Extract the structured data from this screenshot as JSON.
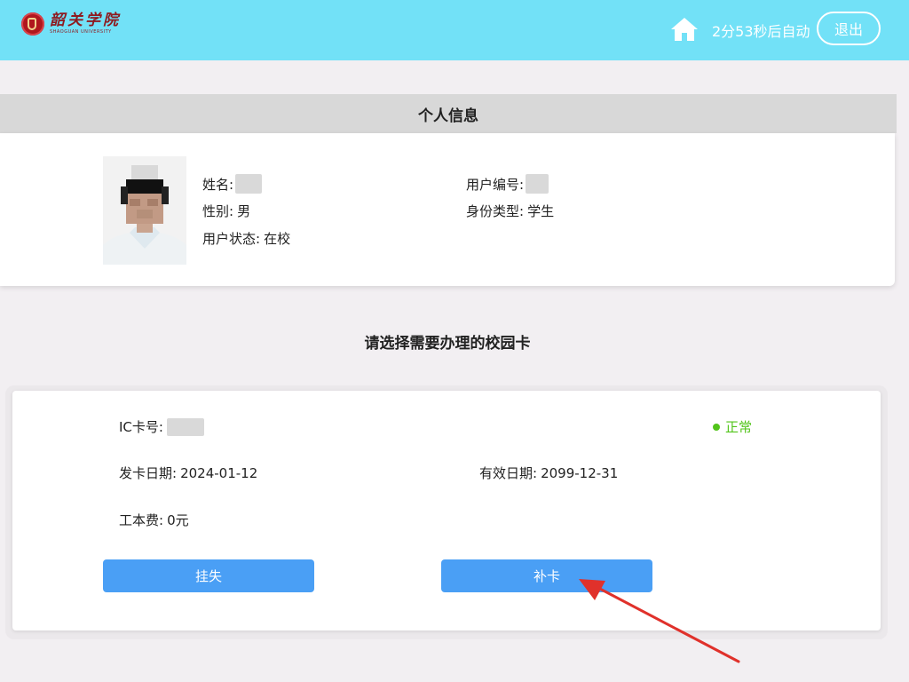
{
  "header": {
    "logo_cn": "韶关学院",
    "logo_en": "SHAOGUAN UNIVERSITY",
    "home_icon": "home-icon",
    "countdown": "2分53秒后自动",
    "logout_label": "退出"
  },
  "profile": {
    "section_title": "个人信息",
    "name_label": "姓名:",
    "user_id_label": "用户编号:",
    "gender_label": "性别:",
    "gender_value": "男",
    "identity_label": "身份类型:",
    "identity_value": "学生",
    "status_label": "用户状态:",
    "status_value": "在校"
  },
  "select_prompt": "请选择需要办理的校园卡",
  "card": {
    "ic_label": "IC卡号:",
    "status": "正常",
    "issue_label": "发卡日期:",
    "issue_date": "2024-01-12",
    "expiry_label": "有效日期:",
    "expiry_date": "2099-12-31",
    "fee_label": "工本费:",
    "fee_value": "0元",
    "report_loss_label": "挂失",
    "reissue_label": "补卡"
  },
  "colors": {
    "topbar": "#72e1f7",
    "button": "#4a9ff5",
    "status_ok": "#52c41a",
    "annotation_arrow": "#e0312b"
  }
}
